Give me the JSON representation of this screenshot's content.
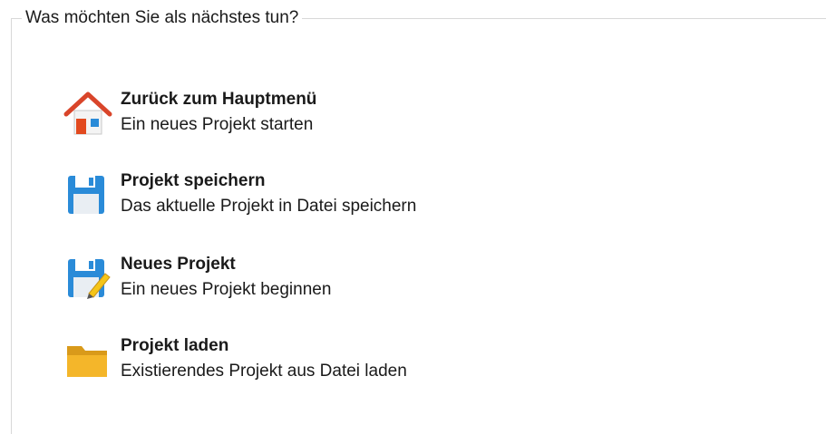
{
  "group": {
    "legend": "Was möchten Sie als nächstes tun?"
  },
  "actions": [
    {
      "icon": "home-icon",
      "title": "Zurück zum Hauptmenü",
      "description": "Ein neues Projekt starten"
    },
    {
      "icon": "floppy-disk-icon",
      "title": "Projekt speichern",
      "description": "Das aktuelle Projekt in Datei speichern"
    },
    {
      "icon": "floppy-disk-pencil-icon",
      "title": "Neues Projekt",
      "description": "Ein neues Projekt beginnen"
    },
    {
      "icon": "folder-icon",
      "title": "Projekt laden",
      "description": "Existierendes Projekt aus Datei laden"
    }
  ],
  "colors": {
    "home_roof": "#d9452a",
    "floppy_blue": "#2a8bd8",
    "folder_yellow": "#f4b62a",
    "pencil_yellow": "#f5c518"
  }
}
